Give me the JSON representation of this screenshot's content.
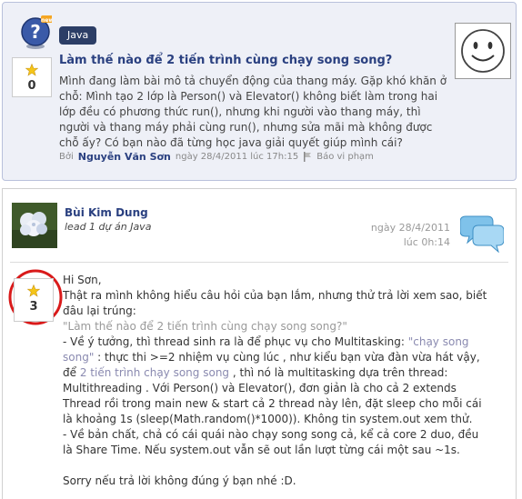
{
  "question": {
    "tag": "Java",
    "votes": "0",
    "title": "Làm thế nào để 2 tiến trình cùng chạy song song?",
    "body": "Mình đang làm bài mô tả chuyển động của thang máy. Gặp khó khăn ở chỗ: Mình tạo 2 lớp là Person() và Elevator() không biết làm trong hai lớp đều có phương thức run(), nhưng khi người vào thang máy, thì người và thang máy phải cùng run(), nhưng sửa mãi mà không được chỗ ấy? Có bạn nào đã từng học java giải quyết giúp mình cái?",
    "by_label": "Bởi",
    "author": "Nguyễn Văn Sơn",
    "date": "ngày 28/4/2011 lúc 17h:15",
    "report": "Báo vi phạm"
  },
  "answer": {
    "author": "Bùi Kim Dung",
    "role": "lead 1 dự án Java",
    "date_line1": "ngày 28/4/2011",
    "date_line2": "lúc 0h:14",
    "votes": "3",
    "greeting": "Hi Sơn,",
    "intro": "Thật ra mình không hiểu câu hỏi của bạn lắm, nhưng thử trả lời xem sao, biết đâu lại trúng:",
    "quote": "\"Làm thế nào để 2 tiến trình cùng chạy song song?\"",
    "p1_a": "- Về ý tưởng, thì thread sinh ra là để phục vụ cho Multitasking: ",
    "p1_hl1": "\"chạy song song\"",
    "p1_b": " : thực thi >=2 nhiệm vụ cùng lúc , như kiểu bạn vừa đàn vừa hát vậy, để ",
    "p1_hl2": "2 tiến trình chạy song song",
    "p1_c": " , thì nó là multitasking dựa trên thread: Multithreading . Với Person() và Elevator(), đơn giản là cho cả 2 extends Thread rồi trong main new & start cả 2 thread này lên, đặt sleep cho mỗi cái là khoảng 1s (sleep(Math.random()*1000)). Không tin system.out xem thử.",
    "p2": "- Về bản chất, chả có cái quái nào chạy song song cả, kể cả core 2 duo, đều là Share Time. Nếu system.out vẫn sẽ out lần lượt từng cái một sau ~1s.",
    "closing": "Sorry nếu trả lời không đúng ý bạn nhé :D."
  },
  "colors": {
    "accent": "#2a4080",
    "tag_bg": "#2c3e66",
    "question_bg": "#eef0f7",
    "highlight_circle": "#d91a1a",
    "star": "#f5c518"
  }
}
